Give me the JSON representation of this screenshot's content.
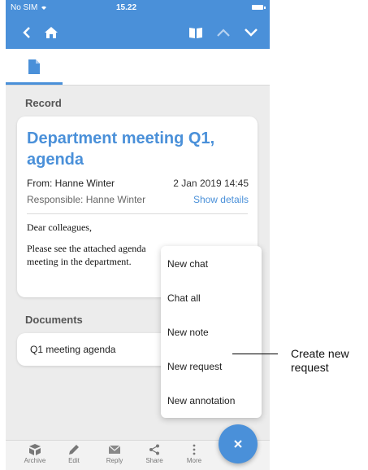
{
  "status_bar": {
    "carrier": "No SIM",
    "time": "15.22"
  },
  "tabs": [
    {
      "icon": "document-icon",
      "active": true
    }
  ],
  "record": {
    "section_label": "Record",
    "title": "Department meeting Q1, agenda",
    "from": "From: Hanne Winter",
    "date": "2 Jan 2019 14:45",
    "responsible": "Responsible: Hanne Winter",
    "show_details": "Show details",
    "body_greeting": "Dear colleagues,",
    "body_line1": "Please see the attached agenda",
    "body_line2": "meeting in the department."
  },
  "documents": {
    "section_label": "Documents",
    "items": [
      {
        "name": "Q1 meeting agenda"
      }
    ]
  },
  "popup_menu": {
    "items": [
      {
        "label": "New chat"
      },
      {
        "label": "Chat all"
      },
      {
        "label": "New note"
      },
      {
        "label": "New request"
      },
      {
        "label": "New annotation"
      }
    ]
  },
  "toolbar": {
    "items": [
      {
        "label": "Archive",
        "icon": "archive-icon"
      },
      {
        "label": "Edit",
        "icon": "pencil-icon"
      },
      {
        "label": "Reply",
        "icon": "envelope-icon"
      },
      {
        "label": "Share",
        "icon": "share-icon"
      },
      {
        "label": "More",
        "icon": "more-vertical-icon"
      }
    ]
  },
  "fab": {
    "icon": "close-icon"
  },
  "callout": {
    "text": "Create new request"
  },
  "colors": {
    "accent": "#4a90d9",
    "background": "#ececec"
  }
}
